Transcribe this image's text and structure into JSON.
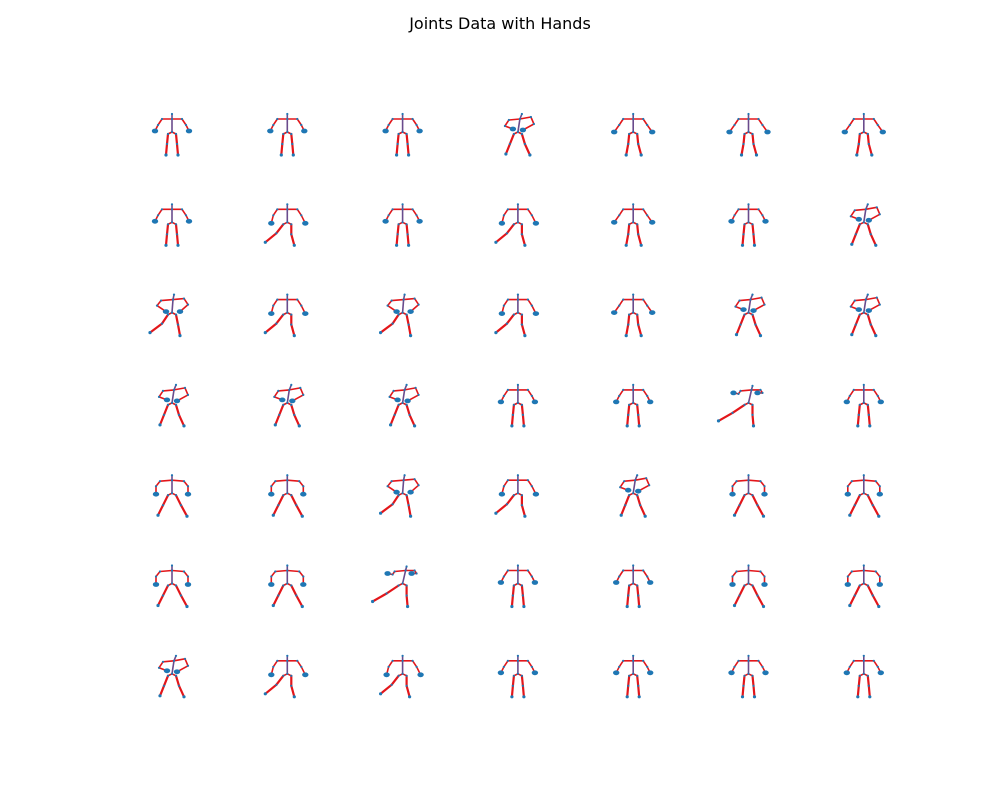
{
  "figure": {
    "title": "Joints Data with Hands"
  },
  "chart_data": {
    "type": "scatter",
    "title": "Joints Data with Hands",
    "layout": "7x7 grid of small multiples",
    "rows": 7,
    "cols": 7,
    "axes_visible": false,
    "grid": false,
    "colors": {
      "bones": "#e3161a",
      "joints": "#1f77b4",
      "spine": "#6a4b8c"
    },
    "poses": [
      [
        "A-stand",
        "A-stand",
        "A-stand",
        "twist-left",
        "A-stand-wide",
        "A-stand-wide",
        "A-stand-wide"
      ],
      [
        "A-stand",
        "kick-left",
        "A-stand",
        "kick-left",
        "A-stand-wide",
        "A-stand",
        "twist-left"
      ],
      [
        "twist-kick",
        "kick-left",
        "twist-kick",
        "kick-left",
        "A-stand-wide",
        "twist-left",
        "twist-left"
      ],
      [
        "twist-left",
        "twist-left",
        "twist-left",
        "A-stand",
        "A-stand",
        "lunge",
        "A-stand"
      ],
      [
        "wide-stance",
        "wide-stance",
        "twist-kick",
        "kick-left",
        "twist-left",
        "wide-stance",
        "wide-stance"
      ],
      [
        "wide-stance",
        "wide-stance",
        "lunge",
        "A-stand",
        "A-stand",
        "wide-stance",
        "wide-stance"
      ],
      [
        "twist-left",
        "kick-left",
        "kick-left",
        "A-stand",
        "A-stand",
        "A-stand",
        "A-stand"
      ]
    ]
  }
}
